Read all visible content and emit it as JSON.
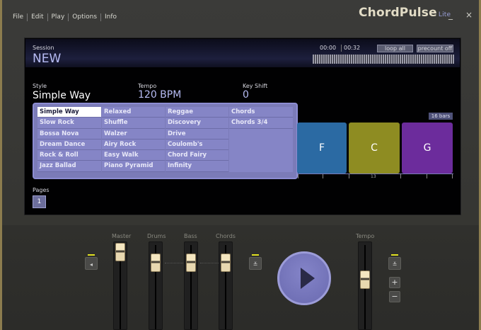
{
  "menu": [
    "File",
    "Edit",
    "Play",
    "Options",
    "Info"
  ],
  "brand": {
    "name": "ChordPulse",
    "edition": "Lite"
  },
  "window": {
    "minimize": "_",
    "close": "×"
  },
  "session": {
    "label": "Session",
    "value": "NEW"
  },
  "transport": {
    "time_start": "00:00",
    "time_end": "00:32",
    "loop": "loop all",
    "precount": "precount off"
  },
  "style": {
    "label": "Style",
    "value": "Simple Way"
  },
  "tempo": {
    "label": "Tempo",
    "value": "120 BPM"
  },
  "keyshift": {
    "label": "Key Shift",
    "value": "0"
  },
  "style_columns": [
    [
      "Simple Way",
      "Slow Rock",
      "Bossa Nova",
      "Dream Dance",
      "Rock & Roll",
      "Jazz Ballad"
    ],
    [
      "Relaxed",
      "Shuffle",
      "Walzer",
      "Airy Rock",
      "Easy Walk",
      "Piano Pyramid"
    ],
    [
      "Reggae",
      "Discovery",
      "Drive",
      "Coulomb's",
      "Chord Fairy",
      "Infinity"
    ],
    [
      "Chords",
      "Chords 3/4"
    ]
  ],
  "selected_style": "Simple Way",
  "bars_badge": "16 bars",
  "chords": [
    {
      "name": "F",
      "color": "#2b6aa3"
    },
    {
      "name": "C",
      "color": "#8e8c22"
    },
    {
      "name": "G",
      "color": "#6c2c9c"
    }
  ],
  "ruler_mark": "13",
  "pages": {
    "label": "Pages",
    "items": [
      "1"
    ]
  },
  "mixer": {
    "master": "Master",
    "drums": "Drums",
    "bass": "Bass",
    "chords": "Chords",
    "tempo": "Tempo",
    "tempo_plus": "+",
    "tempo_minus": "−"
  }
}
